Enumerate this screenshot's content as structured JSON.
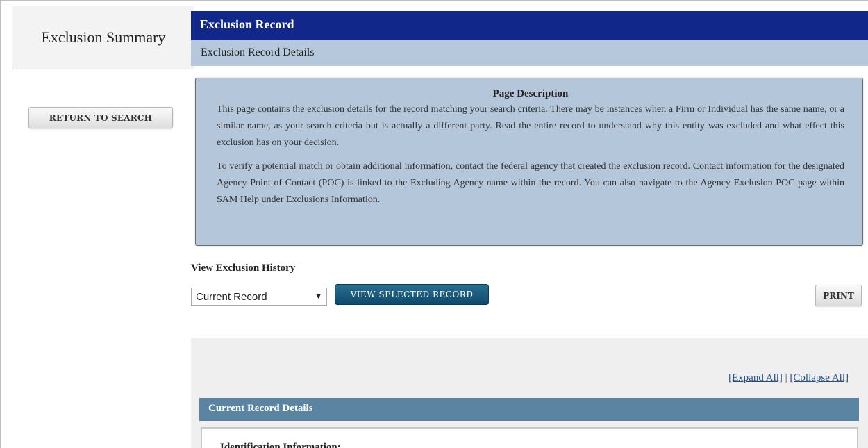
{
  "sidebar": {
    "title": "Exclusion Summary",
    "return_button": "RETURN TO SEARCH"
  },
  "header": {
    "title": "Exclusion Record",
    "subtitle": "Exclusion Record Details"
  },
  "description": {
    "title": "Page Description",
    "paragraph1": "This page contains the exclusion details for the record matching your search criteria. There may be instances when a Firm or Individual has the same name, or a similar name, as your search criteria but is actually a different party. Read the entire record to understand why this entity was excluded and what effect this exclusion has on your decision.",
    "paragraph2": "To verify a potential match or obtain additional information, contact the federal agency that created the exclusion record. Contact information for the designated Agency Point of Contact (POC) is linked to the Excluding Agency name within the record. You can also navigate to the Agency Exclusion POC page within SAM Help under Exclusions Information."
  },
  "history": {
    "label": "View Exclusion History",
    "selected": "Current Record",
    "view_button": "VIEW SELECTED RECORD",
    "print_button": "PRINT"
  },
  "details": {
    "expand_all": "[Expand All]",
    "separator": " | ",
    "collapse_all": "[Collapse All]",
    "section_title": "Current Record Details",
    "identification_label": "Identification Information:"
  },
  "colors": {
    "title_bar": "#11288a",
    "subtitle_bar": "#b6c8db",
    "record_header": "#5a84a2",
    "view_button": "#0e4a6b"
  }
}
